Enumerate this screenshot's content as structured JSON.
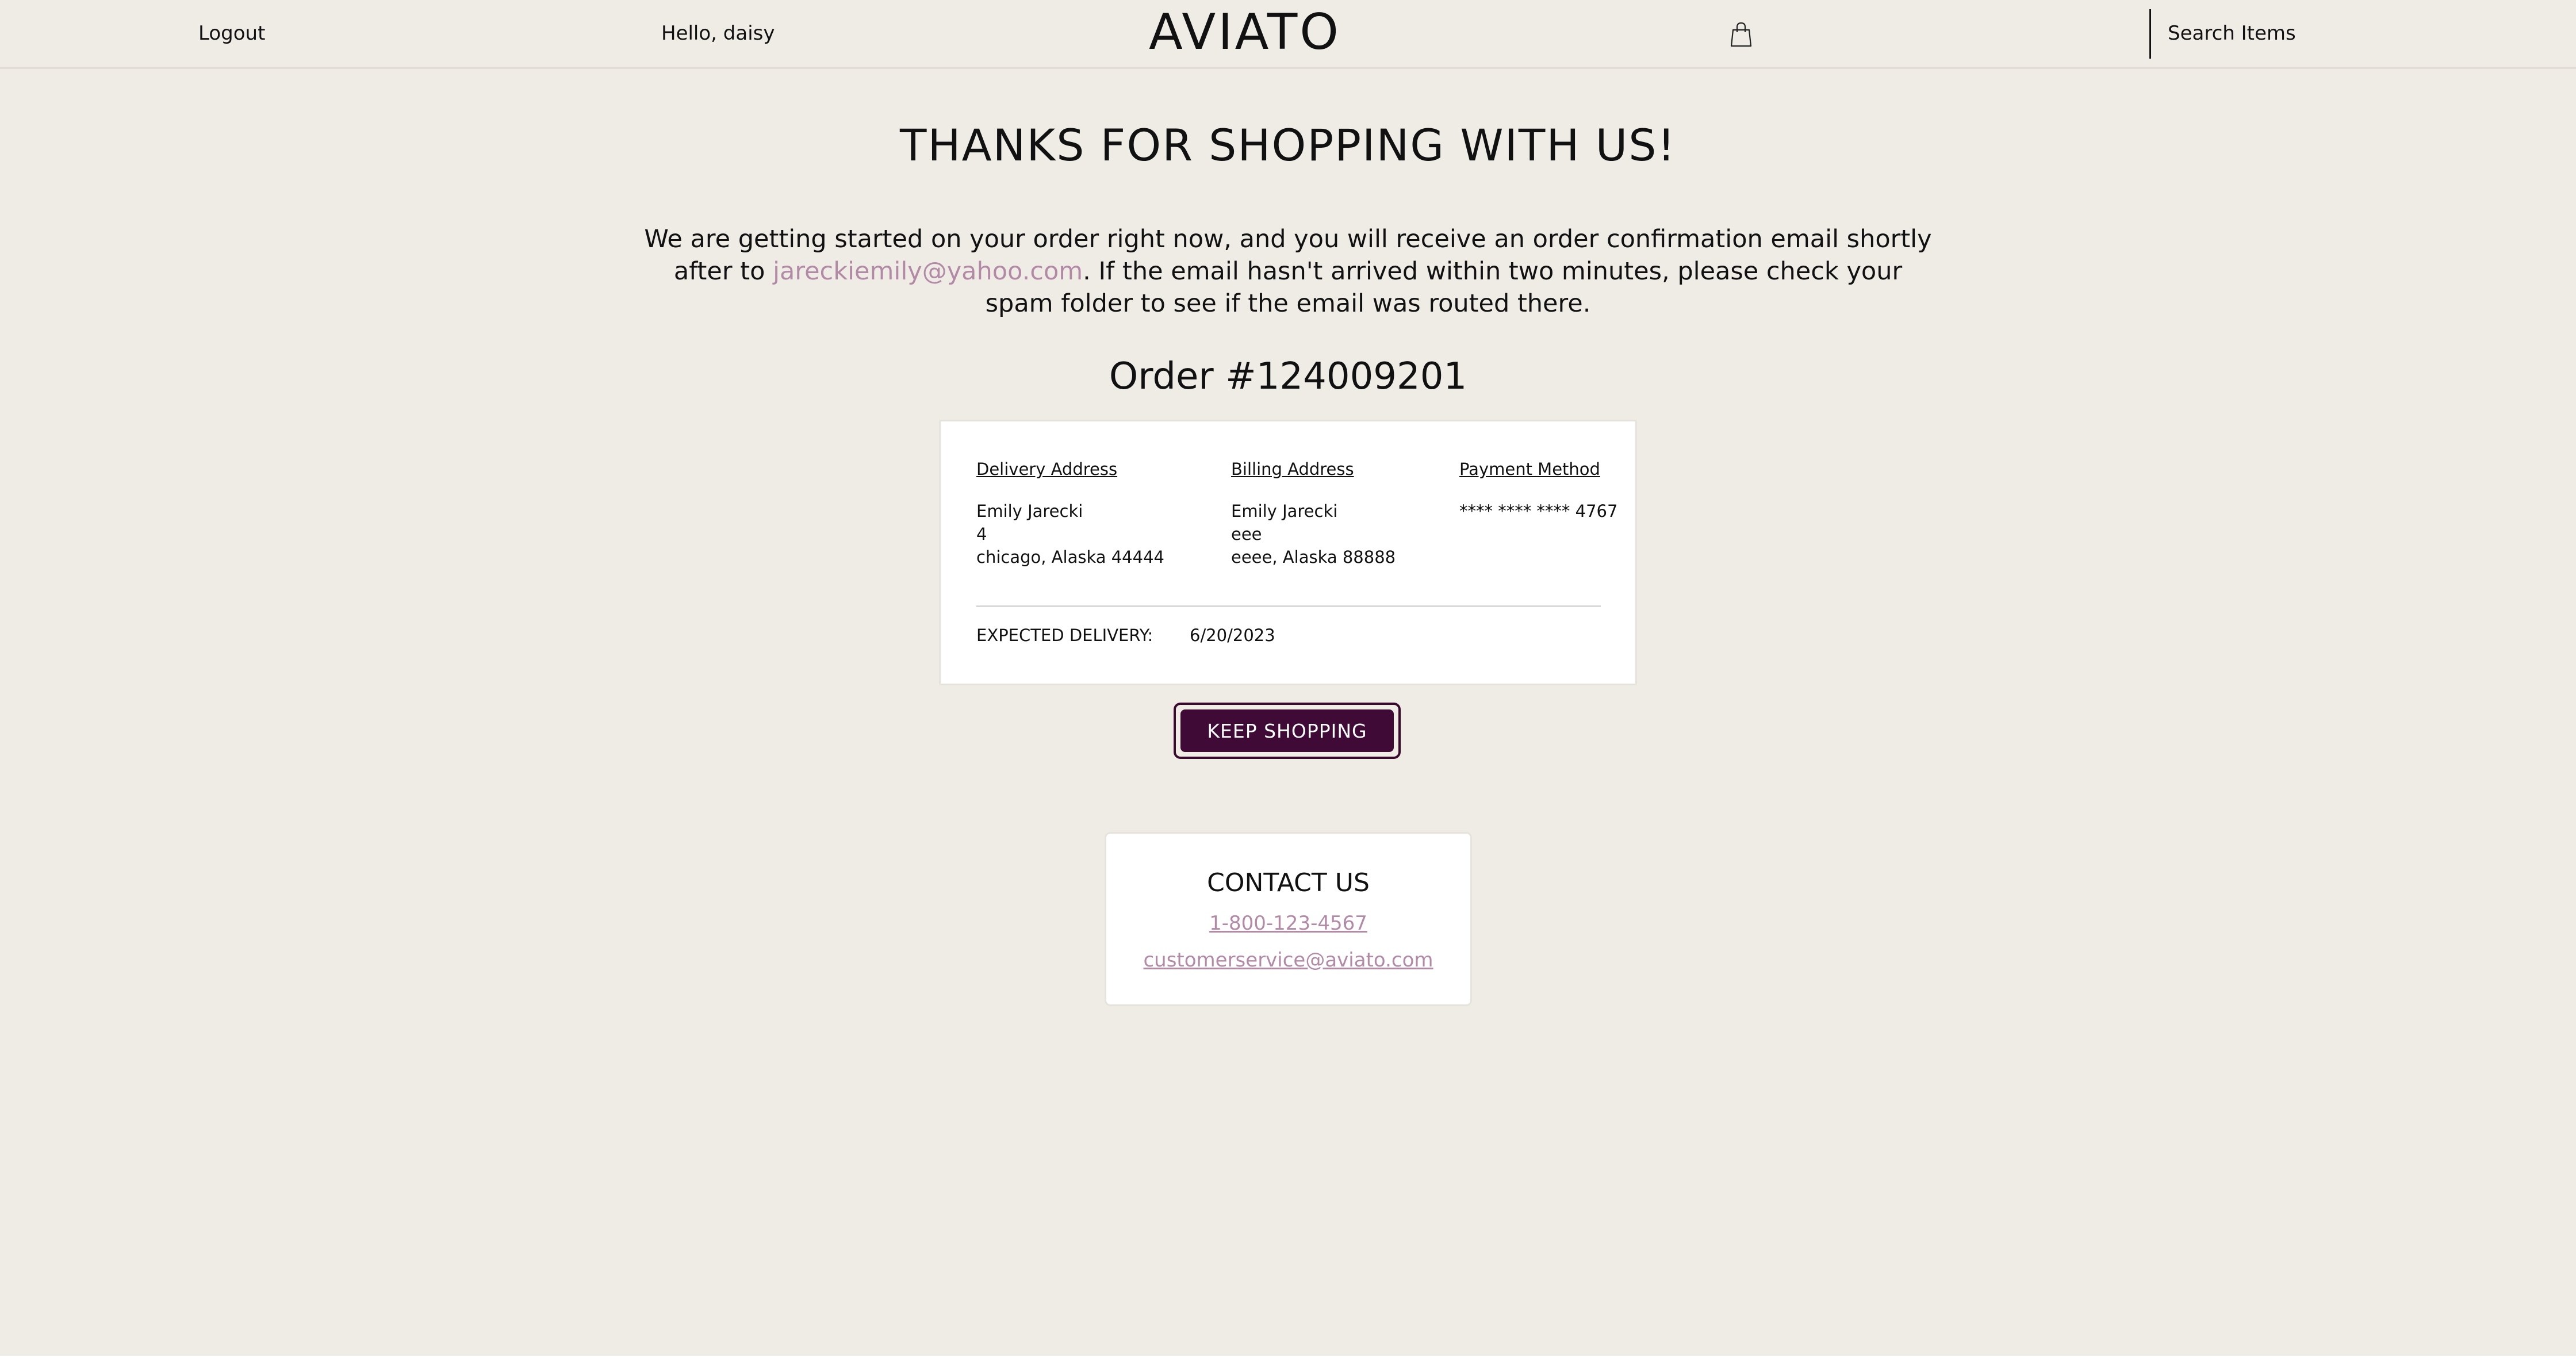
{
  "nav": {
    "logout_label": "Logout",
    "greeting": "Hello, daisy",
    "logo": "AVIATO",
    "cart_icon": "shopping-bag-icon",
    "search_label": "Search Items"
  },
  "confirmation": {
    "heading": "THANKS FOR SHOPPING WITH US!",
    "message_before": "We are getting started on your order right now, and you will receive an order confirmation email shortly after to ",
    "email": "jareckiemily@yahoo.com",
    "message_after": ". If the email hasn't arrived within two minutes, please check your spam folder to see if the email was routed there.",
    "order_title": "Order #124009201"
  },
  "order": {
    "delivery": {
      "heading": "Delivery Address",
      "name": "Emily Jarecki",
      "street": "4",
      "city_line": "chicago, Alaska 44444"
    },
    "billing": {
      "heading": "Billing Address",
      "name": "Emily Jarecki",
      "street": "eee",
      "city_line": "eeee, Alaska 88888"
    },
    "payment": {
      "heading": "Payment Method",
      "card": "**** **** **** 4767"
    },
    "expected_label": "EXPECTED DELIVERY:",
    "expected_date": "6/20/2023"
  },
  "actions": {
    "keep_shopping": "KEEP SHOPPING"
  },
  "contact": {
    "title": "CONTACT US",
    "phone": "1-800-123-4567",
    "email": "customerservice@aviato.com"
  },
  "colors": {
    "background": "#efece6",
    "accent_button": "#3f0a35",
    "link": "#b28aa6"
  }
}
